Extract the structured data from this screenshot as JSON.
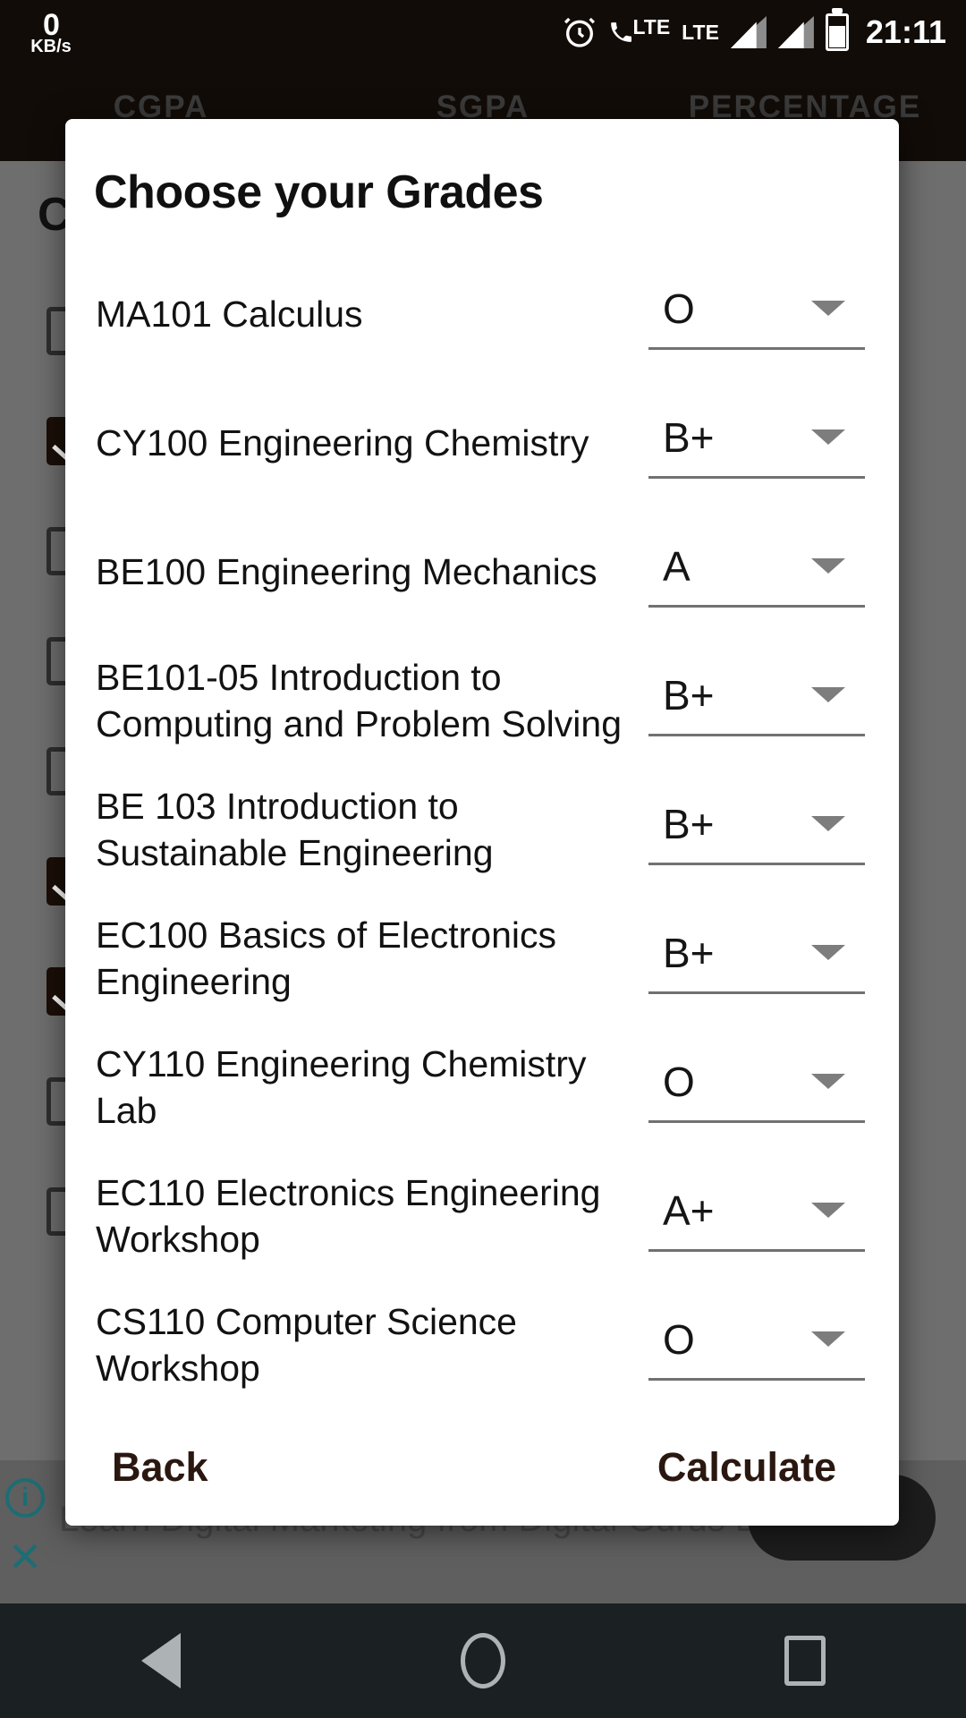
{
  "status_bar": {
    "net_speed_value": "0",
    "net_speed_unit": "KB/s",
    "alarm_icon": "alarm-clock-icon",
    "call_lte_label": "LTE",
    "data_lte_label": "LTE",
    "time": "21:11"
  },
  "background_app": {
    "columns": [
      "CGPA",
      "SGPA",
      "PERCENTAGE"
    ],
    "title": "Ch",
    "checkbox_rows": [
      {
        "checked": false
      },
      {
        "checked": true
      },
      {
        "checked": false
      },
      {
        "checked": false
      },
      {
        "checked": false
      },
      {
        "checked": true
      },
      {
        "checked": true
      },
      {
        "checked": false
      },
      {
        "checked": false
      }
    ]
  },
  "ad": {
    "text": "Learn Digital Marketing from Digital Gurus Digital Labz",
    "info_label": "i",
    "close_label": "✕"
  },
  "dialog": {
    "title": "Choose your Grades",
    "rows": [
      {
        "course": "MA101 Calculus",
        "grade": "O"
      },
      {
        "course": "CY100 Engineering Chemistry",
        "grade": "B+"
      },
      {
        "course": "BE100 Engineering Mechanics",
        "grade": "A"
      },
      {
        "course": "BE101-05 Introduction to Computing and Problem Solving",
        "grade": "B+"
      },
      {
        "course": "BE 103 Introduction to Sustainable Engineering",
        "grade": "B+"
      },
      {
        "course": "EC100 Basics of Electronics Engineering",
        "grade": "B+"
      },
      {
        "course": "CY110 Engineering Chemistry Lab",
        "grade": "O"
      },
      {
        "course": "EC110 Electronics Engineering Workshop",
        "grade": "A+"
      },
      {
        "course": "CS110 Computer Science Workshop",
        "grade": "O"
      }
    ],
    "back_label": "Back",
    "calculate_label": "Calculate"
  },
  "nav_bar": {
    "back": "back-triangle-icon",
    "home": "home-circle-icon",
    "recents": "recents-square-icon"
  },
  "colors": {
    "dialog_bg": "#ffffff",
    "button_text": "#2a1810",
    "scrim": "#6e6e6e",
    "status_bar_bg": "#120c08",
    "nav_bar_bg": "#1b2022",
    "ad_link": "#1d6d73"
  }
}
